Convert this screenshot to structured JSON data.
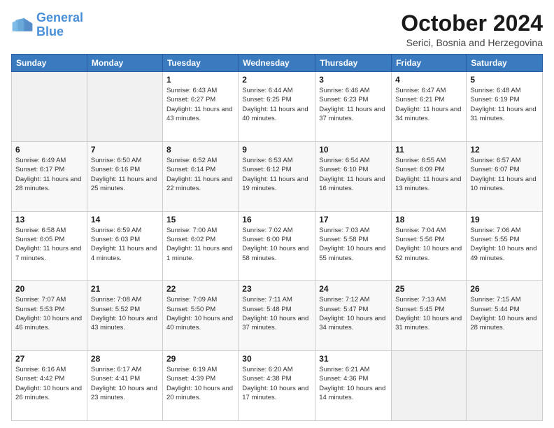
{
  "header": {
    "logo_general": "General",
    "logo_blue": "Blue",
    "month_title": "October 2024",
    "location": "Serici, Bosnia and Herzegovina"
  },
  "days_of_week": [
    "Sunday",
    "Monday",
    "Tuesday",
    "Wednesday",
    "Thursday",
    "Friday",
    "Saturday"
  ],
  "weeks": [
    [
      {
        "day": "",
        "info": ""
      },
      {
        "day": "",
        "info": ""
      },
      {
        "day": "1",
        "info": "Sunrise: 6:43 AM\nSunset: 6:27 PM\nDaylight: 11 hours and 43 minutes."
      },
      {
        "day": "2",
        "info": "Sunrise: 6:44 AM\nSunset: 6:25 PM\nDaylight: 11 hours and 40 minutes."
      },
      {
        "day": "3",
        "info": "Sunrise: 6:46 AM\nSunset: 6:23 PM\nDaylight: 11 hours and 37 minutes."
      },
      {
        "day": "4",
        "info": "Sunrise: 6:47 AM\nSunset: 6:21 PM\nDaylight: 11 hours and 34 minutes."
      },
      {
        "day": "5",
        "info": "Sunrise: 6:48 AM\nSunset: 6:19 PM\nDaylight: 11 hours and 31 minutes."
      }
    ],
    [
      {
        "day": "6",
        "info": "Sunrise: 6:49 AM\nSunset: 6:17 PM\nDaylight: 11 hours and 28 minutes."
      },
      {
        "day": "7",
        "info": "Sunrise: 6:50 AM\nSunset: 6:16 PM\nDaylight: 11 hours and 25 minutes."
      },
      {
        "day": "8",
        "info": "Sunrise: 6:52 AM\nSunset: 6:14 PM\nDaylight: 11 hours and 22 minutes."
      },
      {
        "day": "9",
        "info": "Sunrise: 6:53 AM\nSunset: 6:12 PM\nDaylight: 11 hours and 19 minutes."
      },
      {
        "day": "10",
        "info": "Sunrise: 6:54 AM\nSunset: 6:10 PM\nDaylight: 11 hours and 16 minutes."
      },
      {
        "day": "11",
        "info": "Sunrise: 6:55 AM\nSunset: 6:09 PM\nDaylight: 11 hours and 13 minutes."
      },
      {
        "day": "12",
        "info": "Sunrise: 6:57 AM\nSunset: 6:07 PM\nDaylight: 11 hours and 10 minutes."
      }
    ],
    [
      {
        "day": "13",
        "info": "Sunrise: 6:58 AM\nSunset: 6:05 PM\nDaylight: 11 hours and 7 minutes."
      },
      {
        "day": "14",
        "info": "Sunrise: 6:59 AM\nSunset: 6:03 PM\nDaylight: 11 hours and 4 minutes."
      },
      {
        "day": "15",
        "info": "Sunrise: 7:00 AM\nSunset: 6:02 PM\nDaylight: 11 hours and 1 minute."
      },
      {
        "day": "16",
        "info": "Sunrise: 7:02 AM\nSunset: 6:00 PM\nDaylight: 10 hours and 58 minutes."
      },
      {
        "day": "17",
        "info": "Sunrise: 7:03 AM\nSunset: 5:58 PM\nDaylight: 10 hours and 55 minutes."
      },
      {
        "day": "18",
        "info": "Sunrise: 7:04 AM\nSunset: 5:56 PM\nDaylight: 10 hours and 52 minutes."
      },
      {
        "day": "19",
        "info": "Sunrise: 7:06 AM\nSunset: 5:55 PM\nDaylight: 10 hours and 49 minutes."
      }
    ],
    [
      {
        "day": "20",
        "info": "Sunrise: 7:07 AM\nSunset: 5:53 PM\nDaylight: 10 hours and 46 minutes."
      },
      {
        "day": "21",
        "info": "Sunrise: 7:08 AM\nSunset: 5:52 PM\nDaylight: 10 hours and 43 minutes."
      },
      {
        "day": "22",
        "info": "Sunrise: 7:09 AM\nSunset: 5:50 PM\nDaylight: 10 hours and 40 minutes."
      },
      {
        "day": "23",
        "info": "Sunrise: 7:11 AM\nSunset: 5:48 PM\nDaylight: 10 hours and 37 minutes."
      },
      {
        "day": "24",
        "info": "Sunrise: 7:12 AM\nSunset: 5:47 PM\nDaylight: 10 hours and 34 minutes."
      },
      {
        "day": "25",
        "info": "Sunrise: 7:13 AM\nSunset: 5:45 PM\nDaylight: 10 hours and 31 minutes."
      },
      {
        "day": "26",
        "info": "Sunrise: 7:15 AM\nSunset: 5:44 PM\nDaylight: 10 hours and 28 minutes."
      }
    ],
    [
      {
        "day": "27",
        "info": "Sunrise: 6:16 AM\nSunset: 4:42 PM\nDaylight: 10 hours and 26 minutes."
      },
      {
        "day": "28",
        "info": "Sunrise: 6:17 AM\nSunset: 4:41 PM\nDaylight: 10 hours and 23 minutes."
      },
      {
        "day": "29",
        "info": "Sunrise: 6:19 AM\nSunset: 4:39 PM\nDaylight: 10 hours and 20 minutes."
      },
      {
        "day": "30",
        "info": "Sunrise: 6:20 AM\nSunset: 4:38 PM\nDaylight: 10 hours and 17 minutes."
      },
      {
        "day": "31",
        "info": "Sunrise: 6:21 AM\nSunset: 4:36 PM\nDaylight: 10 hours and 14 minutes."
      },
      {
        "day": "",
        "info": ""
      },
      {
        "day": "",
        "info": ""
      }
    ]
  ]
}
